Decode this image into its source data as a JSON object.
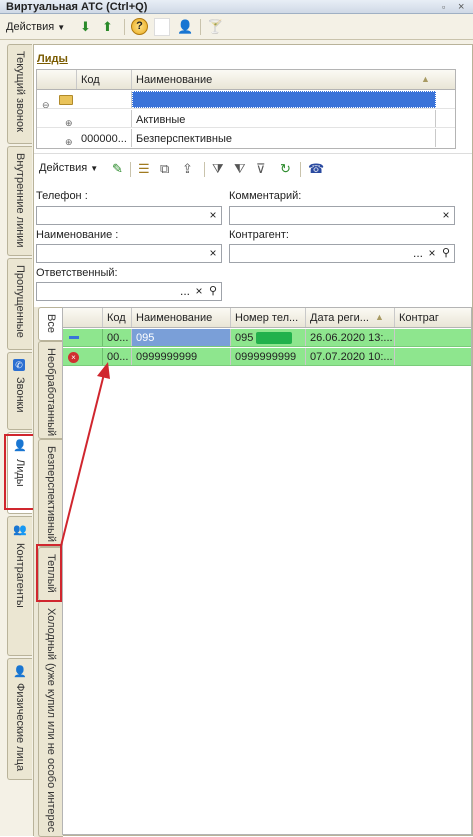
{
  "window": {
    "title": "Виртуальная АТС (Ctrl+Q)"
  },
  "toolbar": {
    "actions_label": "Действия",
    "help_label": "?"
  },
  "vertical_tabs": [
    {
      "label": "Текущий звонок"
    },
    {
      "label": "Внутренние линии"
    },
    {
      "label": "Пропущенные"
    },
    {
      "label": "Звонки"
    },
    {
      "label": "Лиды"
    },
    {
      "label": "Контрагенты"
    },
    {
      "label": "Физические лица"
    }
  ],
  "leads_section": {
    "title": "Лиды",
    "columns": [
      "Код",
      "Наименование"
    ],
    "rows": [
      {
        "code": "",
        "name": ""
      },
      {
        "code": "",
        "name": "Активные"
      },
      {
        "code": "000000...",
        "name": "Безперспективные"
      }
    ]
  },
  "list_toolbar": {
    "actions_label": "Действия"
  },
  "filters": {
    "phone_label": "Телефон :",
    "comment_label": "Комментарий:",
    "name_label": "Наименование :",
    "counterparty_label": "Контрагент:",
    "responsible_label": "Ответственный:",
    "dots": "...",
    "clear": "×"
  },
  "status_tabs": [
    {
      "label": "Все"
    },
    {
      "label": "Необработанный"
    },
    {
      "label": "Безперспективный"
    },
    {
      "label": "Теплый"
    },
    {
      "label": "Холодный (уже купил или не особо интерес"
    }
  ],
  "calls_table": {
    "columns": [
      "Код",
      "Наименование",
      "Номер тел...",
      "Дата реги...",
      "Контраг"
    ],
    "rows": [
      {
        "code": "00...",
        "name": "095",
        "phone": "095",
        "date": "26.06.2020 13:...",
        "counterparty": ""
      },
      {
        "code": "00...",
        "name": "0999999999",
        "phone": "0999999999",
        "date": "07.07.2020 10:...",
        "counterparty": ""
      }
    ]
  },
  "colors": {
    "row_highlight": "#8ee68e",
    "selection": "#3a73d9",
    "annotation": "#d0262e"
  }
}
